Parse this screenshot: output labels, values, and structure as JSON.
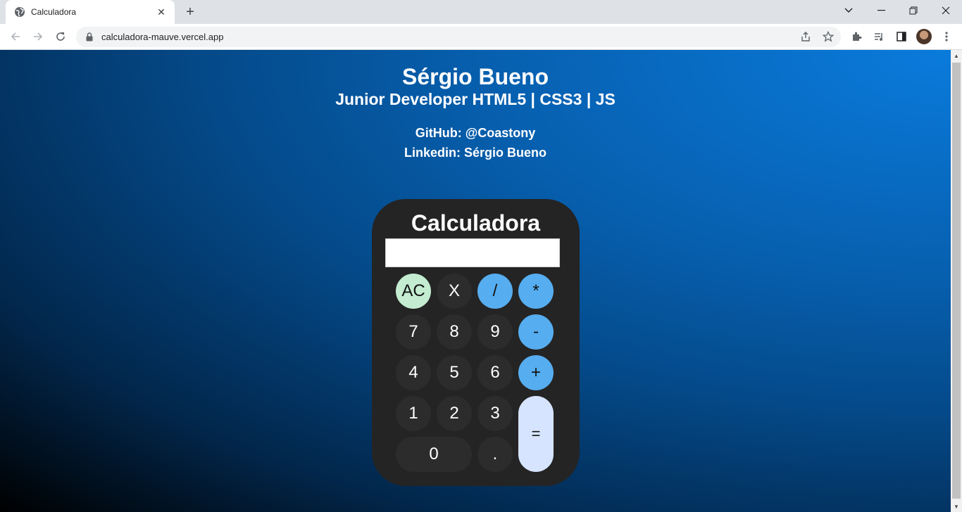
{
  "browser": {
    "tab_title": "Calculadora",
    "url": "calculadora-mauve.vercel.app"
  },
  "page": {
    "name": "Sérgio Bueno",
    "role": "Junior Developer HTML5 | CSS3 | JS",
    "github": "GitHub: @Coastony",
    "linkedin": "Linkedin: Sérgio Bueno"
  },
  "calculator": {
    "title": "Calculadora",
    "display_value": "",
    "keys": {
      "ac": "AC",
      "del": "X",
      "divide": "/",
      "multiply": "*",
      "seven": "7",
      "eight": "8",
      "nine": "9",
      "minus": "-",
      "four": "4",
      "five": "5",
      "six": "6",
      "plus": "+",
      "one": "1",
      "two": "2",
      "three": "3",
      "equals": "=",
      "zero": "0",
      "dot": "."
    }
  },
  "colors": {
    "operator_key": "#56adf0",
    "clear_key": "#c3ecd0",
    "equals_key": "#d6e4ff",
    "calculator_body": "#242424"
  }
}
